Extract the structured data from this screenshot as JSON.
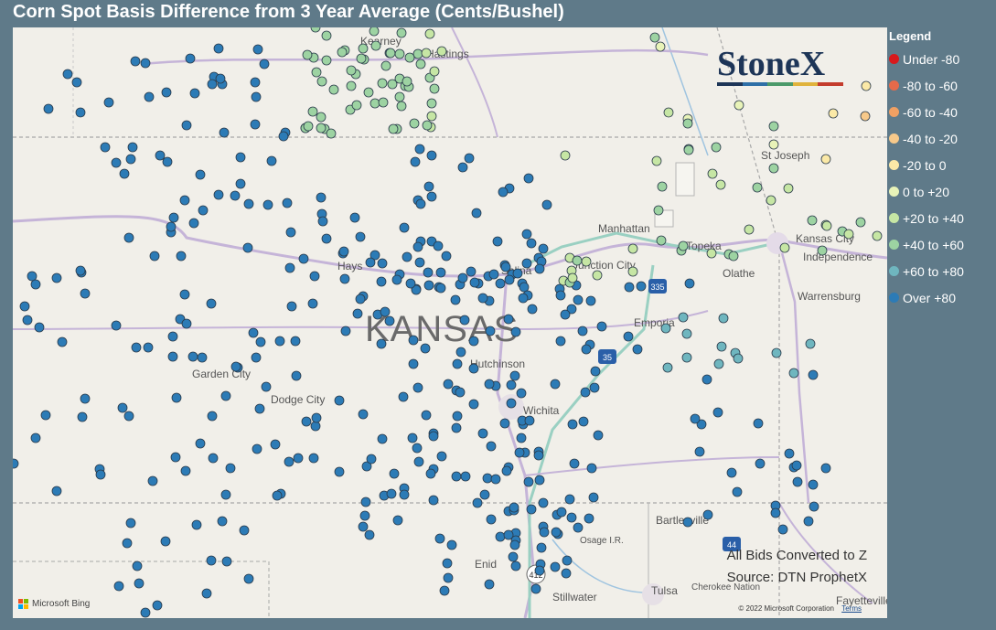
{
  "title": "Corn Spot Basis Difference from 3 Year Average (Cents/Bushel)",
  "state_label": "KANSAS",
  "logo_text": "StoneX",
  "logo_colors": [
    "#1d3557",
    "#2e6fa7",
    "#4c9a6a",
    "#e0b33c",
    "#c43c2d"
  ],
  "notes": [
    "All Bids Converted to Z",
    "Source: DTN ProphetX"
  ],
  "bing_label": "Microsoft Bing",
  "copyright": "© 2022 Microsoft Corporation",
  "terms_label": "Terms",
  "legend": {
    "title": "Legend",
    "items": [
      {
        "label": "Under -80",
        "color": "#d7191c"
      },
      {
        "label": "-80 to -60",
        "color": "#e66a4a"
      },
      {
        "label": "-60 to -40",
        "color": "#f0a063"
      },
      {
        "label": "-40 to -20",
        "color": "#f7c98a"
      },
      {
        "label": "-20 to 0",
        "color": "#fbe9a7"
      },
      {
        "label": "0 to +20",
        "color": "#e8f3b8"
      },
      {
        "label": "+20 to +40",
        "color": "#c6e6a4"
      },
      {
        "label": "+40 to +60",
        "color": "#9dd3a2"
      },
      {
        "label": "+60 to +80",
        "color": "#6fb6bf"
      },
      {
        "label": "Over +80",
        "color": "#2c7bb6"
      }
    ]
  },
  "cities": [
    "Kearney",
    "Hastings",
    "St Joseph",
    "Manhattan",
    "Topeka",
    "Kansas City",
    "Independence",
    "Olathe",
    "Hays",
    "Salina",
    "Junction City",
    "Emporia",
    "Warrensburg",
    "Garden City",
    "Dodge City",
    "Hutchinson",
    "Wichita",
    "Bartlesville",
    "Osage I.R.",
    "Enid",
    "Stillwater",
    "Tulsa",
    "Cherokee Nation",
    "Fayetteville"
  ],
  "highways": [
    "335",
    "35",
    "412",
    "44"
  ]
}
